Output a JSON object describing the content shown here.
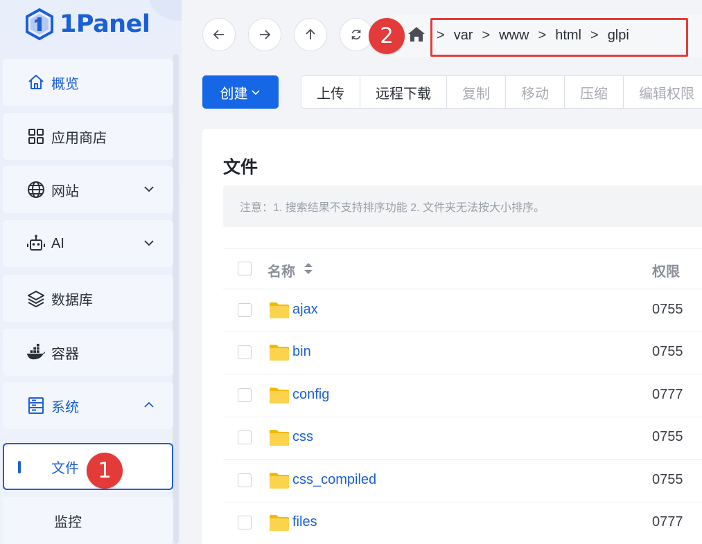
{
  "app": {
    "name": "1Panel"
  },
  "sidebar": {
    "items": [
      {
        "label": "概览",
        "icon": "home-icon"
      },
      {
        "label": "应用商店",
        "icon": "app-store-icon"
      },
      {
        "label": "网站",
        "icon": "globe-icon",
        "expandable": true
      },
      {
        "label": "AI",
        "icon": "robot-icon",
        "expandable": true
      },
      {
        "label": "数据库",
        "icon": "database-layers-icon"
      },
      {
        "label": "容器",
        "icon": "docker-icon"
      },
      {
        "label": "系统",
        "icon": "system-icon",
        "expanded": true
      }
    ],
    "sub_items": [
      {
        "label": "文件",
        "selected": true
      },
      {
        "label": "监控"
      }
    ]
  },
  "annotations": {
    "badge_1": "1",
    "badge_2": "2"
  },
  "path": {
    "segments": [
      "var",
      "www",
      "html",
      "glpi"
    ],
    "separator": ">"
  },
  "toolbar": {
    "create_label": "创建",
    "buttons": [
      {
        "label": "上传",
        "enabled": true
      },
      {
        "label": "远程下载",
        "enabled": true
      },
      {
        "label": "复制",
        "enabled": false
      },
      {
        "label": "移动",
        "enabled": false
      },
      {
        "label": "压缩",
        "enabled": false
      },
      {
        "label": "编辑权限",
        "enabled": false
      }
    ]
  },
  "panel": {
    "title": "文件",
    "notice": "注意：1. 搜索结果不支持排序功能 2. 文件夹无法按大小排序。",
    "columns": {
      "name": "名称",
      "permission": "权限"
    },
    "rows": [
      {
        "name": "ajax",
        "permission": "0755"
      },
      {
        "name": "bin",
        "permission": "0755"
      },
      {
        "name": "config",
        "permission": "0777"
      },
      {
        "name": "css",
        "permission": "0755"
      },
      {
        "name": "css_compiled",
        "permission": "0755"
      },
      {
        "name": "files",
        "permission": "0777"
      }
    ]
  },
  "colors": {
    "accent": "#1667e6",
    "badge": "#e43a3a",
    "folder": "#fcd34d"
  }
}
